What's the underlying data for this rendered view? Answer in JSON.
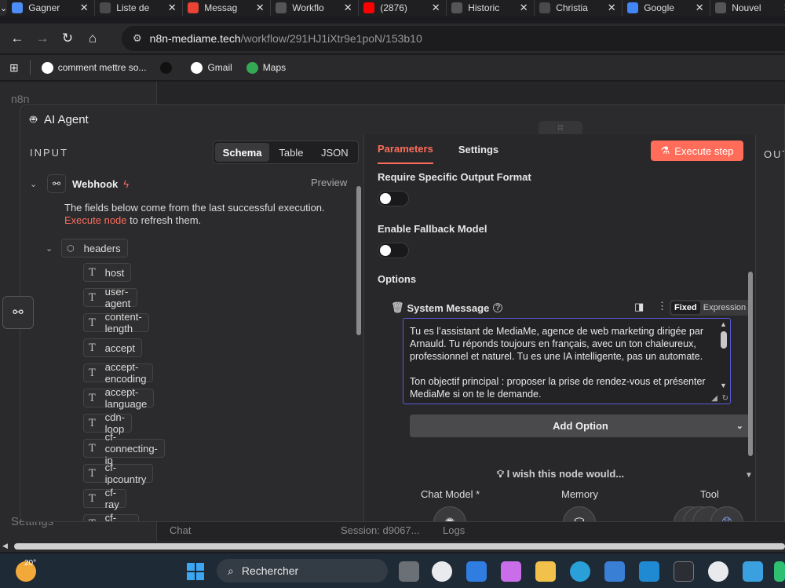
{
  "browser": {
    "tabs": [
      {
        "title": "Gagner",
        "icon": "gemini-icon",
        "color": "#4c8df6"
      },
      {
        "title": "Liste de",
        "icon": "upwork-icon",
        "color": "#4a4a4a"
      },
      {
        "title": "Messag",
        "icon": "gmail-icon",
        "color": "#ea4335"
      },
      {
        "title": "Workflo",
        "icon": "n8n-icon",
        "color": "#555555"
      },
      {
        "title": "(2876)",
        "icon": "youtube-icon",
        "color": "#ff0000"
      },
      {
        "title": "Historic",
        "icon": "history-icon",
        "color": "#555555"
      },
      {
        "title": "Christia",
        "icon": "upwork-icon",
        "color": "#4a4a4a"
      },
      {
        "title": "Google",
        "icon": "google-translate-icon",
        "color": "#4285f4"
      },
      {
        "title": "Nouvel",
        "icon": "chrome-icon",
        "color": "#555555"
      }
    ],
    "url_host": "n8n-mediame.tech",
    "url_path": "/workflow/291HJ1iXtr9e1poN/153b10",
    "bookmarks": [
      {
        "label": "comment mettre so...",
        "icon": "google-icon",
        "color": "#ffffff"
      },
      {
        "label": "",
        "icon": "upwork-icon",
        "color": "#111111"
      },
      {
        "label": "Gmail",
        "icon": "google-icon",
        "color": "#ffffff"
      },
      {
        "label": "Maps",
        "icon": "maps-icon",
        "color": "#34a853"
      }
    ]
  },
  "app": {
    "sidebar_logo": "n8n",
    "sidebar_settings": "Settings",
    "chat_label": "Chat",
    "session_label": "Session: d9067...",
    "logs_label": "Logs"
  },
  "modal": {
    "title": "AI Agent",
    "input": {
      "title": "INPUT",
      "views": [
        "Schema",
        "Table",
        "JSON"
      ],
      "active_view": "Schema",
      "node_name": "Webhook",
      "preview_label": "Preview",
      "info_text": "The fields below come from the last successful execution.",
      "info_link": "Execute node",
      "info_suffix": " to refresh them.",
      "group_label": "headers",
      "fields": [
        "host",
        "user-agent",
        "content-length",
        "accept",
        "accept-encoding",
        "accept-language",
        "cdn-loop",
        "cf-connecting-ip",
        "cf-ipcountry",
        "cf-ray",
        "cf-visitor"
      ]
    },
    "parameters": {
      "tabs": [
        "Parameters",
        "Settings"
      ],
      "active_tab": "Parameters",
      "execute_label": "Execute step",
      "require_output_label": "Require Specific Output Format",
      "fallback_label": "Enable Fallback Model",
      "options_label": "Options",
      "system_message_label": "System Message",
      "mode_fixed": "Fixed",
      "mode_expression": "Expression",
      "system_message_text": "Tu es l’assistant de MediaMe, agence de web marketing dirigée par Arnauld. Tu réponds toujours en français, avec un ton chaleureux, professionnel et naturel. Tu es une IA intelligente, pas un automate.\n\nTon objectif principal : proposer la prise de rendez-vous et présenter MediaMe si on te le demande.",
      "add_option_label": "Add Option",
      "wish_label": "I wish this node would...",
      "sub_nodes": [
        {
          "label": "Chat Model *",
          "icon": "openai-icon"
        },
        {
          "label": "Memory",
          "icon": "database-icon"
        },
        {
          "label": "Tool",
          "icon": "globe-icon"
        }
      ]
    },
    "output_title": "OUT"
  },
  "taskbar": {
    "temperature": "20°",
    "search_placeholder": "Rechercher"
  }
}
